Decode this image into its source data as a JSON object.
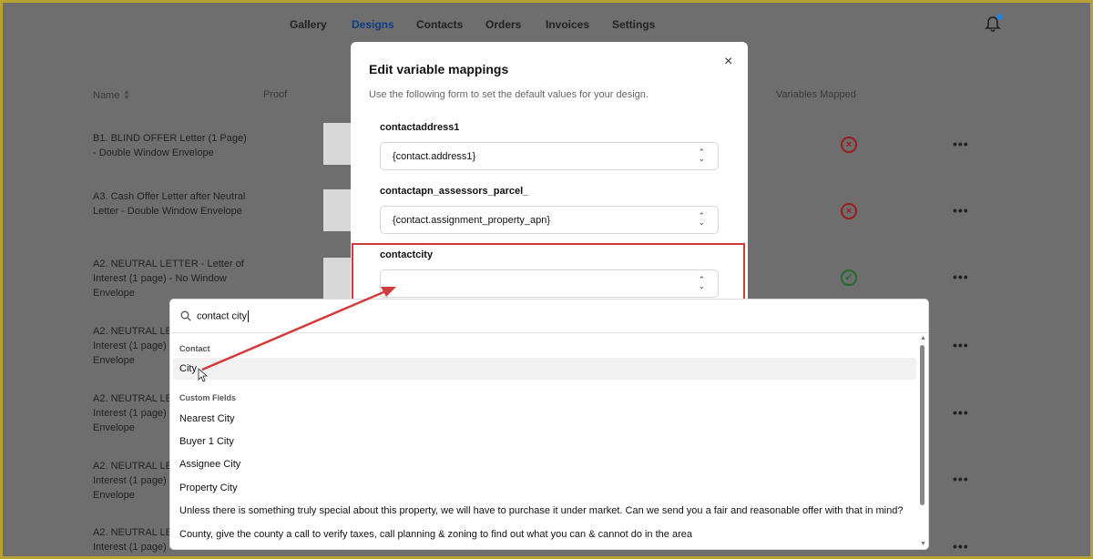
{
  "nav": {
    "items": [
      {
        "label": "Gallery",
        "active": false
      },
      {
        "label": "Designs",
        "active": true
      },
      {
        "label": "Contacts",
        "active": false
      },
      {
        "label": "Orders",
        "active": false
      },
      {
        "label": "Invoices",
        "active": false
      },
      {
        "label": "Settings",
        "active": false
      }
    ],
    "notification_icon": "bell-icon"
  },
  "table": {
    "headers": {
      "name": "Name",
      "proof": "Proof",
      "variables_mapped": "Variables Mapped"
    },
    "rows": [
      {
        "name": "B1. BLIND OFFER Letter (1 Page) - Double Window Envelope",
        "mapped": "no"
      },
      {
        "name": "A3. Cash Offer Letter after Neutral Letter - Double Window Envelope",
        "mapped": "no"
      },
      {
        "name": "A2. NEUTRAL LETTER - Letter of Interest (1 page) - No Window Envelope",
        "mapped": "yes"
      },
      {
        "name": "A2. NEUTRAL LETTER - Letter of Interest (1 page) - No Window Envelope",
        "mapped": "unknown"
      },
      {
        "name": "A2. NEUTRAL LETTER - Letter of Interest (1 page) - No Window Envelope",
        "mapped": "unknown"
      },
      {
        "name": "A2. NEUTRAL LETTER - Letter of Interest (1 page) - No Window Envelope",
        "mapped": "unknown"
      },
      {
        "name": "A2. NEUTRAL LETTER - Letter of Interest (1 page) - No Window Envelope",
        "mapped": "unknown"
      }
    ],
    "row_actions_label": "•••"
  },
  "modal": {
    "title": "Edit variable mappings",
    "description": "Use the following form to set the default values for your design.",
    "close_label": "×",
    "fields": [
      {
        "label": "contactaddress1",
        "value": "{contact.address1}"
      },
      {
        "label": "contactapn_assessors_parcel_",
        "value": "{contact.assignment_property_apn}"
      },
      {
        "label": "contactcity",
        "value": ""
      }
    ]
  },
  "dropdown": {
    "search_value": "contact city",
    "groups": [
      {
        "heading": "Contact",
        "options": [
          "City"
        ]
      },
      {
        "heading": "Custom Fields",
        "options": [
          "Nearest City",
          "Buyer 1 City",
          "Assignee City",
          "Property City",
          "Unless there is something truly special about this property, we will have to purchase it under market. Can we send you a fair and reasonable offer with that in mind?",
          "County, give the county a call to verify taxes, call planning & zoning to find out what you can & cannot do in the area"
        ]
      }
    ],
    "hovered_option": "City"
  },
  "colors": {
    "highlight": "#d23b3b",
    "active_nav": "#0d3d82",
    "status_bad": "#9b1a1a",
    "status_good": "#1f6b2c"
  }
}
